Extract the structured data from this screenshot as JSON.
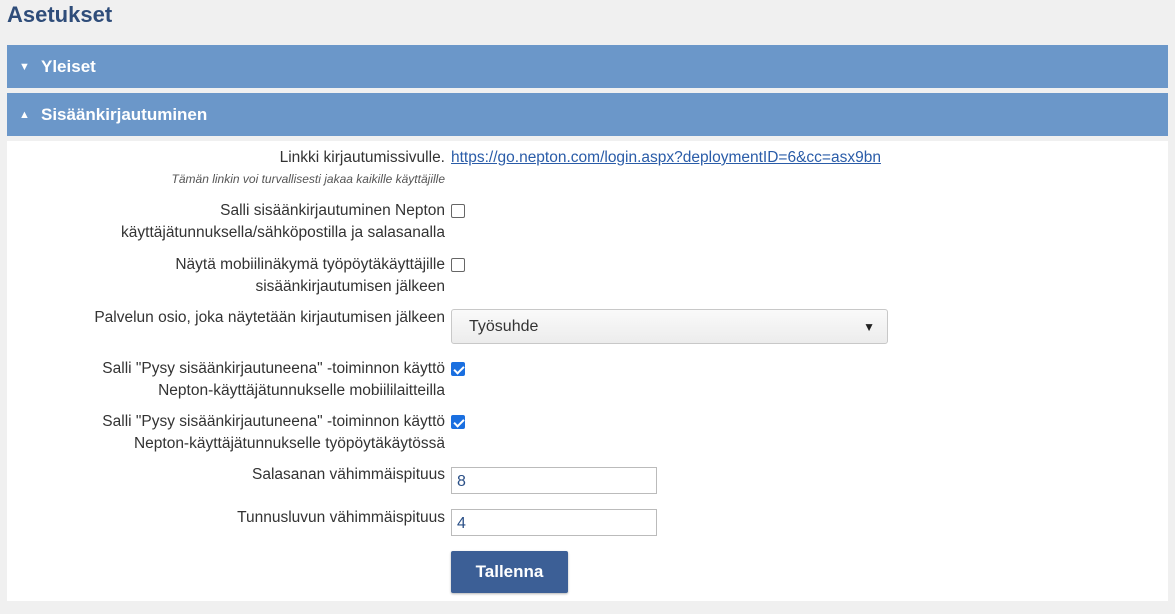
{
  "page": {
    "title": "Asetukset"
  },
  "sections": {
    "general": {
      "label": "Yleiset",
      "caret": "▼"
    },
    "login": {
      "label": "Sisäänkirjautuminen",
      "caret": "▲"
    }
  },
  "login": {
    "link_label": "Linkki kirjautumissivulle.",
    "link_hint": "Tämän linkin voi turvallisesti jakaa kaikille käyttäjille",
    "link_url": "https://go.nepton.com/login.aspx?deploymentID=6&cc=asx9bn",
    "allow_nepton_login_label_1": "Salli sisäänkirjautuminen Nepton",
    "allow_nepton_login_label_2": "käyttäjätunnuksella/sähköpostilla ja salasanalla",
    "allow_nepton_login_checked": false,
    "mobile_view_label_1": "Näytä mobiilinäkymä työpöytäkäyttäjille",
    "mobile_view_label_2": "sisäänkirjautumisen jälkeen",
    "mobile_view_checked": false,
    "landing_section_label": "Palvelun osio, joka näytetään kirjautumisen jälkeen",
    "landing_section_value": "Työsuhde",
    "stay_logged_mobile_label_1": "Salli \"Pysy sisäänkirjautuneena\" -toiminnon käyttö",
    "stay_logged_mobile_label_2": "Nepton-käyttäjätunnukselle mobiililaitteilla",
    "stay_logged_mobile_checked": true,
    "stay_logged_desktop_label_1": "Salli \"Pysy sisäänkirjautuneena\" -toiminnon käyttö",
    "stay_logged_desktop_label_2": "Nepton-käyttäjätunnukselle työpöytäkäytössä",
    "stay_logged_desktop_checked": true,
    "min_password_label": "Salasanan vähimmäispituus",
    "min_password_value": "8",
    "min_pin_label": "Tunnusluvun vähimmäispituus",
    "min_pin_value": "4",
    "save_label": "Tallenna"
  },
  "icons": {
    "collapse": "caret-down-icon",
    "expand": "caret-up-icon",
    "select_arrow": "triangle-down-icon"
  },
  "colors": {
    "header_bg": "#6b97c9",
    "title": "#2f4d7a",
    "link": "#2a5ca8",
    "button": "#3c5f96",
    "checkbox_checked": "#1a6fe0"
  }
}
